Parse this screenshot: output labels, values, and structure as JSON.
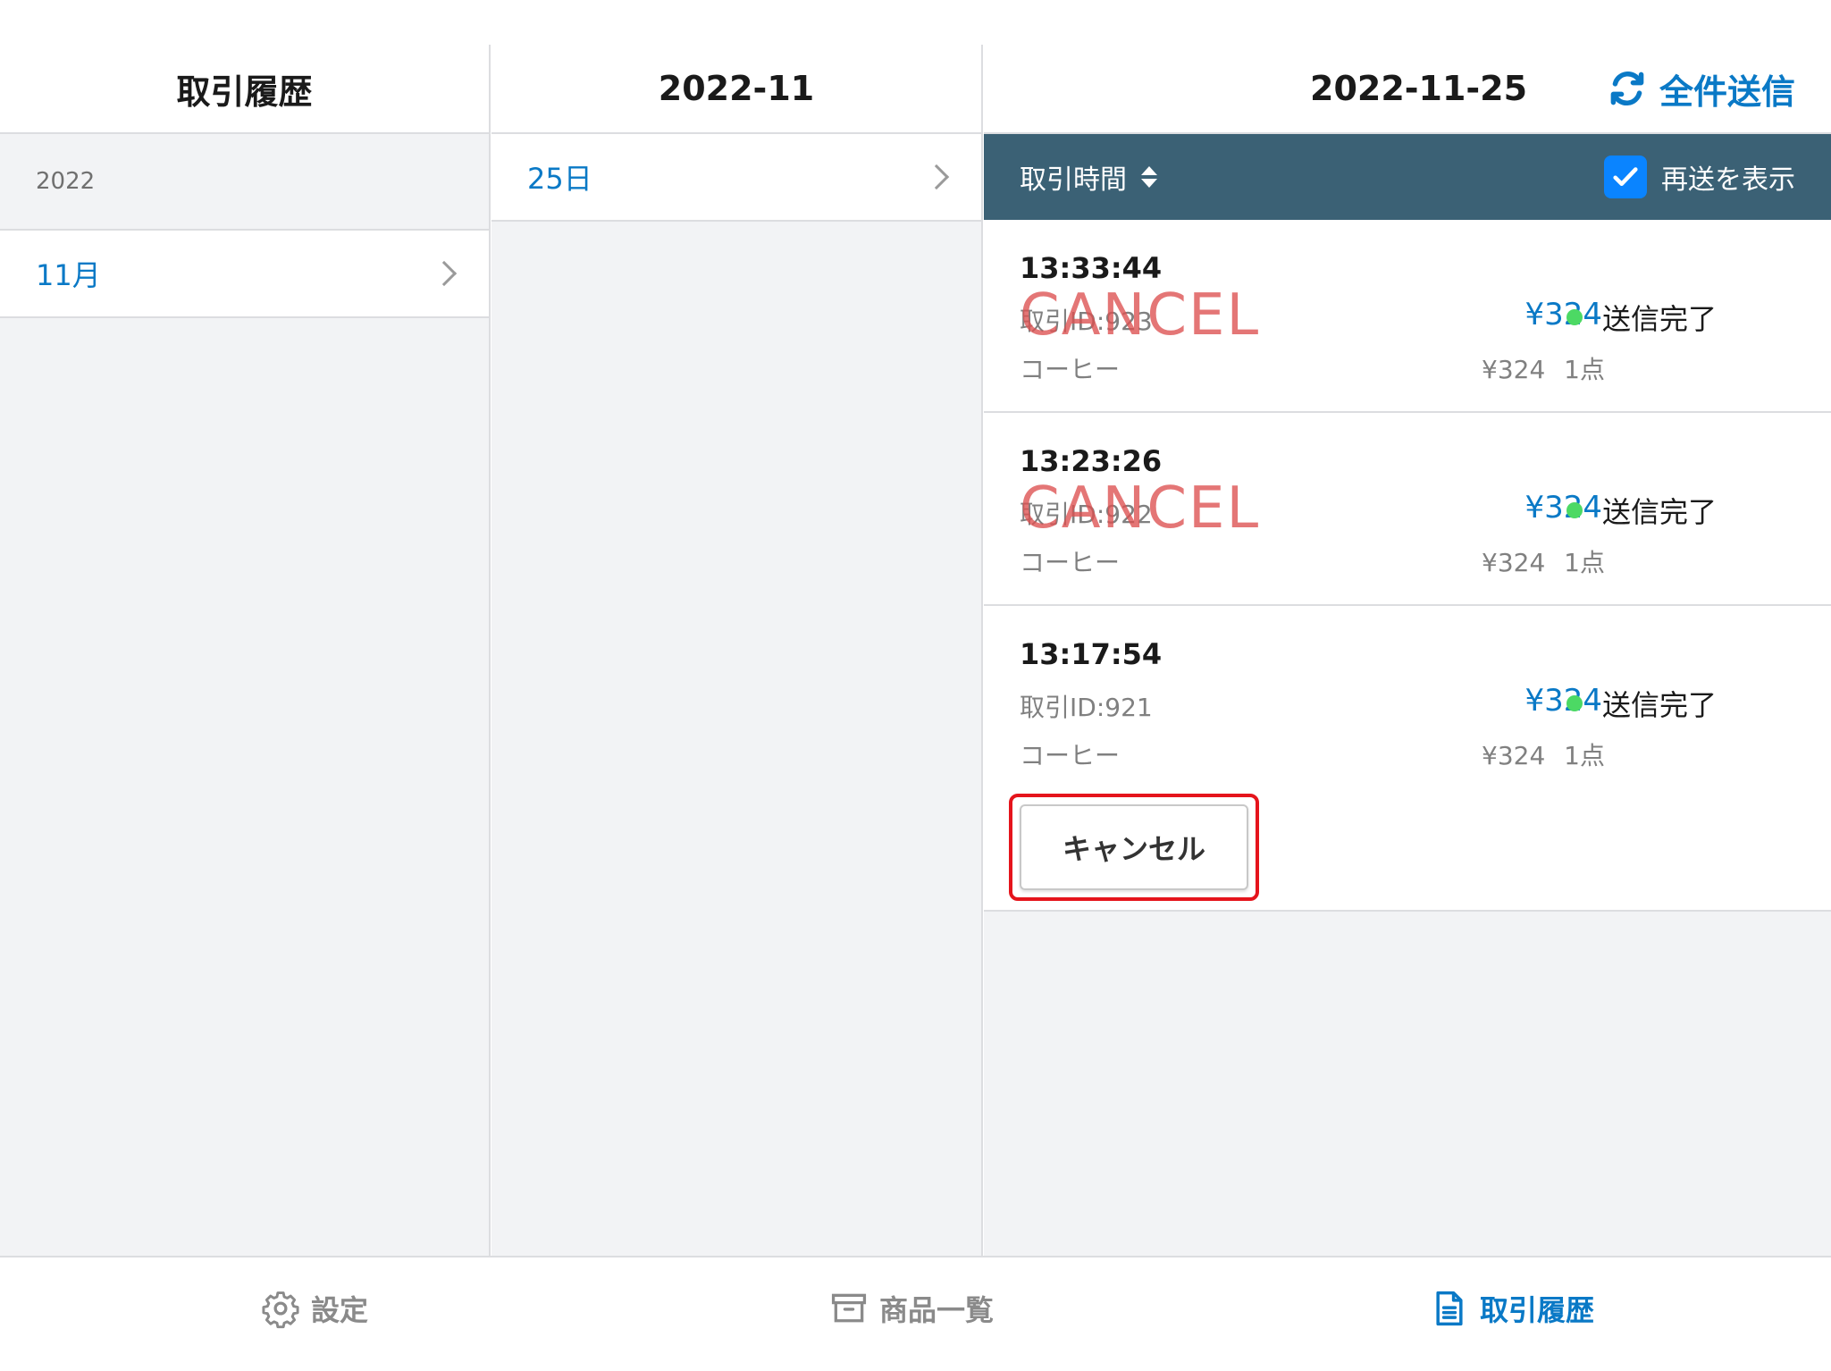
{
  "column1": {
    "title": "取引履歴",
    "year": "2022",
    "months": [
      {
        "label": "11月"
      }
    ]
  },
  "column2": {
    "title": "2022-11",
    "days": [
      {
        "label": "25日"
      }
    ]
  },
  "column3": {
    "title": "2022-11-25",
    "send_all_label": "全件送信",
    "sort_label": "取引時間",
    "resend_label": "再送を表示",
    "resend_checked": true,
    "transactions": [
      {
        "time": "13:33:44",
        "id": "取引ID:923",
        "item": "コーヒー",
        "price": "¥324",
        "sub": "¥324 1点",
        "status": "送信完了",
        "stamp": "CANCEL"
      },
      {
        "time": "13:23:26",
        "id": "取引ID:922",
        "item": "コーヒー",
        "price": "¥324",
        "sub": "¥324 1点",
        "status": "送信完了",
        "stamp": "CANCEL"
      },
      {
        "time": "13:17:54",
        "id": "取引ID:921",
        "item": "コーヒー",
        "price": "¥324",
        "sub": "¥324 1点",
        "status": "送信完了",
        "cancel_button": "キャンセル"
      }
    ]
  },
  "tabbar": {
    "settings": "設定",
    "products": "商品一覧",
    "history": "取引履歴"
  },
  "colors": {
    "accent": "#0a79c6",
    "header_bar": "#3b6175",
    "status_ok": "#4cd964",
    "cancel_stamp": "#dc5050",
    "highlight": "#e5141c"
  }
}
